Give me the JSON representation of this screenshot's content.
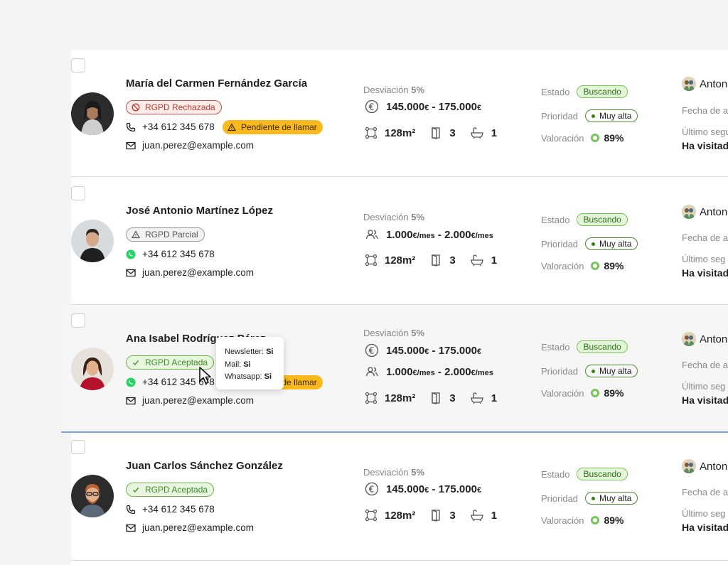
{
  "rows": [
    {
      "name": "María del Carmen Fernández García",
      "rgpd": "RGPD Rechazada",
      "phone": "+34 612 345 678",
      "pending": "Pendiente de llamar",
      "email": "juan.perez@example.com",
      "deviation_label": "Desviación",
      "deviation_value": "5%",
      "price": "145.000",
      "price_to": "175.000",
      "currency": "€",
      "area": "128m²",
      "rooms": "3",
      "baths": "1",
      "estado_label": "Estado",
      "estado": "Buscando",
      "prioridad_label": "Prioridad",
      "prioridad": "Muy alta",
      "valoracion_label": "Valoración",
      "valoracion": "89%",
      "agent": "Anton",
      "fecha": "Fecha de a",
      "ultimo": "Último segu",
      "visitado": "Ha visitado"
    },
    {
      "name": "José Antonio Martínez López",
      "rgpd": "RGPD Parcial",
      "phone": "+34 612 345 678",
      "email": "juan.perez@example.com",
      "deviation_label": "Desviación",
      "deviation_value": "5%",
      "rent": "1.000",
      "rent_to": "2.000",
      "rent_unit": "€/mes",
      "area": "128m²",
      "rooms": "3",
      "baths": "1",
      "estado_label": "Estado",
      "estado": "Buscando",
      "prioridad_label": "Prioridad",
      "prioridad": "Muy alta",
      "valoracion_label": "Valoración",
      "valoracion": "89%",
      "agent": "Anton",
      "fecha": "Fecha de a",
      "ultimo": "Último seg",
      "visitado": "Ha visitad"
    },
    {
      "name": "Ana Isabel Rodríguez Pérez",
      "rgpd": "RGPD Aceptada",
      "phone": "+34 612 345 678",
      "pending": "Pendiente de llamar",
      "email": "juan.perez@example.com",
      "deviation_label": "Desviación",
      "deviation_value": "5%",
      "price": "145.000",
      "price_to": "175.000",
      "currency": "€",
      "rent": "1.000",
      "rent_to": "2.000",
      "rent_unit": "€/mes",
      "area": "128m²",
      "rooms": "3",
      "baths": "1",
      "estado_label": "Estado",
      "estado": "Buscando",
      "prioridad_label": "Prioridad",
      "prioridad": "Muy alta",
      "valoracion_label": "Valoración",
      "valoracion": "89%",
      "agent": "Anton",
      "fecha": "Fecha de a",
      "ultimo": "Último seg",
      "visitado": "Ha visitad"
    },
    {
      "name": "Juan Carlos Sánchez González",
      "rgpd": "RGPD Aceptada",
      "phone": "+34 612 345 678",
      "email": "juan.perez@example.com",
      "deviation_label": "Desviación",
      "deviation_value": "5%",
      "price": "145.000",
      "price_to": "175.000",
      "currency": "€",
      "area": "128m²",
      "rooms": "3",
      "baths": "1",
      "estado_label": "Estado",
      "estado": "Buscando",
      "prioridad_label": "Prioridad",
      "prioridad": "Muy alta",
      "valoracion_label": "Valoración",
      "valoracion": "89%",
      "agent": "Anton",
      "fecha": "Fecha de a",
      "ultimo": "Último seg",
      "visitado": "Ha visitad"
    }
  ],
  "tooltip": {
    "newsletter_label": "Newsletter:",
    "newsletter_value": "Si",
    "mail_label": "Mail:",
    "mail_value": "Si",
    "whatsapp_label": "Whatsapp:",
    "whatsapp_value": "Si"
  },
  "colors": {
    "rejected": "#d24a3e",
    "accepted": "#6ab84c",
    "pending": "#f9b81b",
    "whatsapp": "#25d366",
    "highlight_border": "#7aa3e6"
  }
}
